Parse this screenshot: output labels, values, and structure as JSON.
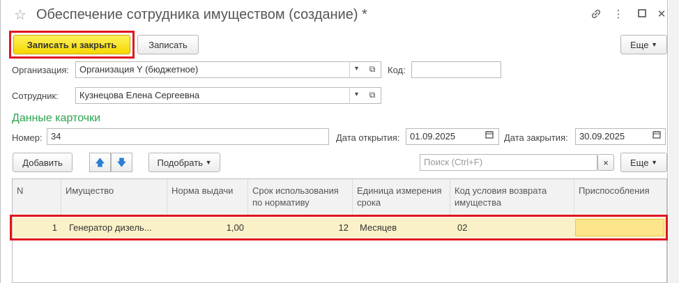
{
  "window": {
    "title": "Обеспечение сотрудника имуществом (создание) *"
  },
  "toolbar": {
    "save_close_label": "Записать и закрыть",
    "save_label": "Записать",
    "more_label": "Еще"
  },
  "form": {
    "org_label": "Организация:",
    "org_value": "Организация Y (бюджетное)",
    "code_label": "Код:",
    "code_value": "",
    "employee_label": "Сотрудник:",
    "employee_value": "Кузнецова Елена Сергеевна"
  },
  "card": {
    "section_title": "Данные карточки",
    "number_label": "Номер:",
    "number_value": "34",
    "open_date_label": "Дата открытия:",
    "open_date_value": "01.09.2025",
    "close_date_label": "Дата закрытия:",
    "close_date_value": "30.09.2025"
  },
  "table_toolbar": {
    "add_label": "Добавить",
    "pick_label": "Подобрать",
    "search_placeholder": "Поиск (Ctrl+F)",
    "clear_label": "×",
    "more_label": "Еще"
  },
  "table": {
    "columns": [
      "N",
      "Имущество",
      "Норма выдачи",
      "Срок использования по нормативу",
      "Единица измерения срока",
      "Код условия возврата имущества",
      "Приспособления"
    ],
    "rows": [
      {
        "n": "1",
        "item": "Генератор дизель...",
        "norm": "1,00",
        "term": "12",
        "unit": "Месяцев",
        "code": "02",
        "tools": ""
      }
    ]
  },
  "icons": {
    "star": "star-icon",
    "link": "link-icon",
    "menu": "more-vert-icon",
    "maximize": "maximize-icon",
    "close": "close-icon",
    "calendar": "calendar-icon",
    "up": "arrow-up-icon",
    "down": "arrow-down-icon"
  },
  "colors": {
    "primary_button": "#f5d800",
    "highlight_frame": "#e0141e",
    "section_title": "#2ba24c",
    "selected_row": "#faf1c8",
    "selected_cell": "#fde58a"
  }
}
